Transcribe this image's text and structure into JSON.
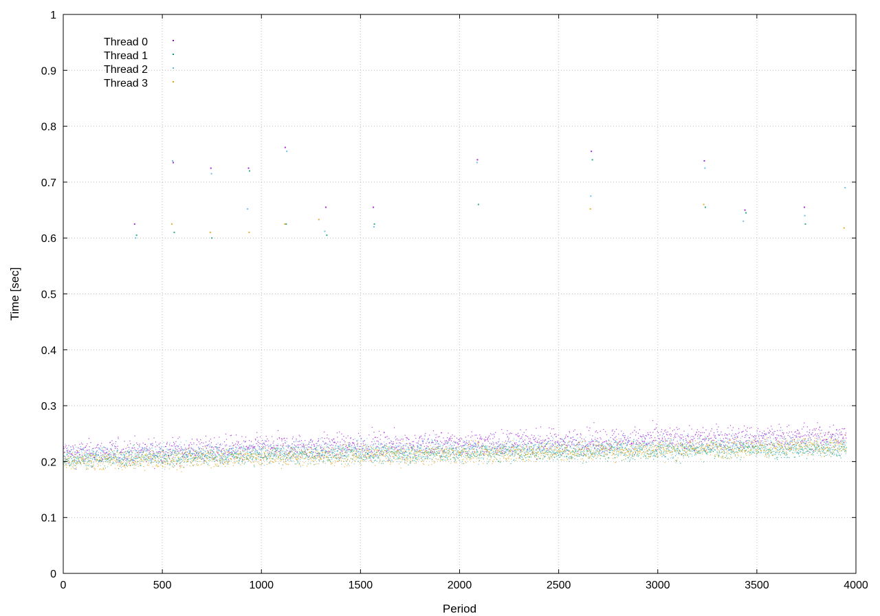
{
  "chart_data": {
    "type": "scatter",
    "title": "",
    "xlabel": "Period",
    "ylabel": "Time [sec]",
    "xlim": [
      0,
      4000
    ],
    "ylim": [
      0,
      1
    ],
    "x_ticks": [
      0,
      500,
      1000,
      1500,
      2000,
      2500,
      3000,
      3500,
      4000
    ],
    "x_tick_labels": [
      "0",
      "500",
      "1000",
      "1500",
      "2000",
      "2500",
      "3000",
      "3500",
      "4000"
    ],
    "y_ticks": [
      0,
      0.1,
      0.2,
      0.3,
      0.4,
      0.5,
      0.6,
      0.7,
      0.8,
      0.9,
      1
    ],
    "y_tick_labels": [
      "0",
      "0.1",
      "0.2",
      "0.3",
      "0.4",
      "0.5",
      "0.6",
      "0.7",
      "0.8",
      "0.9",
      "1"
    ],
    "grid": true,
    "legend_position": "top-left",
    "series": [
      {
        "name": "Thread 0",
        "color": "#9400d3",
        "x_range": [
          0,
          3950
        ],
        "trend": [
          [
            0,
            0.215
          ],
          [
            1000,
            0.225
          ],
          [
            2000,
            0.232
          ],
          [
            3000,
            0.24
          ],
          [
            3950,
            0.245
          ]
        ],
        "spread": 0.022,
        "outliers": [
          [
            360,
            0.625
          ],
          [
            555,
            0.735
          ],
          [
            745,
            0.725
          ],
          [
            935,
            0.725
          ],
          [
            1120,
            0.762
          ],
          [
            1325,
            0.655
          ],
          [
            1565,
            0.655
          ],
          [
            2090,
            0.74
          ],
          [
            2665,
            0.755
          ],
          [
            3235,
            0.738
          ],
          [
            3440,
            0.65
          ],
          [
            3740,
            0.655
          ]
        ]
      },
      {
        "name": "Thread 1",
        "color": "#009e73",
        "x_range": [
          0,
          3950
        ],
        "trend": [
          [
            0,
            0.205
          ],
          [
            1000,
            0.212
          ],
          [
            2000,
            0.215
          ],
          [
            3000,
            0.22
          ],
          [
            3950,
            0.222
          ]
        ],
        "spread": 0.016,
        "outliers": [
          [
            370,
            0.605
          ],
          [
            560,
            0.61
          ],
          [
            750,
            0.6
          ],
          [
            940,
            0.72
          ],
          [
            1125,
            0.625
          ],
          [
            1330,
            0.605
          ],
          [
            1570,
            0.625
          ],
          [
            2095,
            0.66
          ],
          [
            2670,
            0.74
          ],
          [
            3240,
            0.655
          ],
          [
            3445,
            0.645
          ],
          [
            3745,
            0.625
          ]
        ]
      },
      {
        "name": "Thread 2",
        "color": "#56b4e9",
        "x_range": [
          0,
          3950
        ],
        "trend": [
          [
            0,
            0.21
          ],
          [
            1000,
            0.216
          ],
          [
            2000,
            0.222
          ],
          [
            3000,
            0.228
          ],
          [
            3950,
            0.232
          ]
        ],
        "spread": 0.02,
        "outliers": [
          [
            365,
            0.6
          ],
          [
            552,
            0.738
          ],
          [
            748,
            0.715
          ],
          [
            930,
            0.652
          ],
          [
            1128,
            0.755
          ],
          [
            1320,
            0.612
          ],
          [
            1568,
            0.62
          ],
          [
            2088,
            0.735
          ],
          [
            2662,
            0.675
          ],
          [
            3238,
            0.725
          ],
          [
            3432,
            0.63
          ],
          [
            3742,
            0.64
          ],
          [
            3945,
            0.69
          ]
        ]
      },
      {
        "name": "Thread 3",
        "color": "#e69f00",
        "x_range": [
          0,
          3950
        ],
        "trend": [
          [
            0,
            0.2
          ],
          [
            1000,
            0.208
          ],
          [
            2000,
            0.214
          ],
          [
            3000,
            0.222
          ],
          [
            3950,
            0.228
          ]
        ],
        "spread": 0.017,
        "outliers": [
          [
            548,
            0.625
          ],
          [
            742,
            0.61
          ],
          [
            938,
            0.61
          ],
          [
            1118,
            0.625
          ],
          [
            1290,
            0.633
          ],
          [
            2660,
            0.652
          ],
          [
            3232,
            0.66
          ],
          [
            3940,
            0.618
          ]
        ]
      }
    ]
  }
}
